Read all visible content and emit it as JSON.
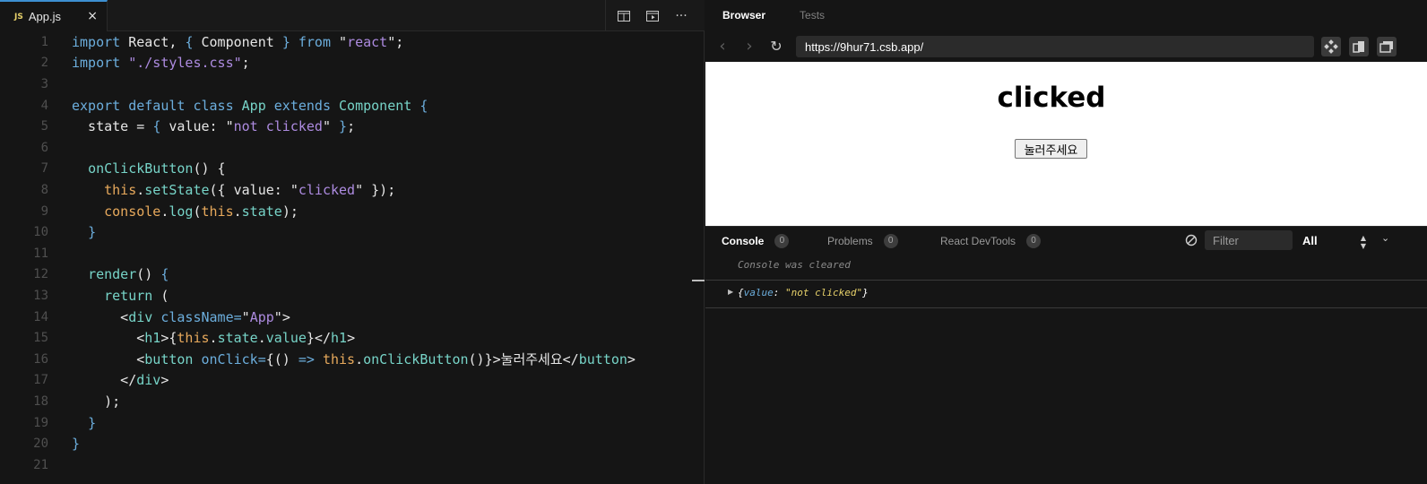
{
  "editor": {
    "tab": {
      "badge": "JS",
      "label": "App.js",
      "close": "×"
    },
    "actions": {
      "more": "···"
    },
    "line_numbers": [
      "1",
      "2",
      "3",
      "4",
      "5",
      "6",
      "7",
      "8",
      "9",
      "10",
      "11",
      "12",
      "13",
      "14",
      "15",
      "16",
      "17",
      "18",
      "19",
      "20",
      "21"
    ],
    "code": {
      "l1": {
        "a": "import",
        "b": " React, ",
        "c": "{",
        "d": " Component ",
        "e": "}",
        "f": " from ",
        "g": "\"",
        "h": "react",
        "i": "\"",
        "j": ";"
      },
      "l2": {
        "a": "import",
        "b": " ",
        "c": "\"./styles.css\"",
        "d": ";"
      },
      "l4": {
        "a": "export",
        "b": " ",
        "c": "default",
        "d": " ",
        "e": "class",
        "f": " ",
        "g": "App",
        "h": " ",
        "i": "extends",
        "j": " ",
        "k": "Component",
        "l": " ",
        "m": "{"
      },
      "l5": {
        "a": "  state = ",
        "b": "{",
        "c": " value: ",
        "d": "\"",
        "e": "not clicked",
        "f": "\"",
        "g": " ",
        "h": "}",
        "i": ";"
      },
      "l7": {
        "a": "  ",
        "b": "onClickButton",
        "c": "() {"
      },
      "l8": {
        "a": "    ",
        "b": "this",
        "c": ".",
        "d": "setState",
        "e": "({ value: ",
        "f": "\"",
        "g": "clicked",
        "h": "\"",
        "i": " });"
      },
      "l9": {
        "a": "    ",
        "b": "console",
        "c": ".",
        "d": "log",
        "e": "(",
        "f": "this",
        "g": ".",
        "h": "state",
        "i": ");"
      },
      "l10": {
        "a": "  ",
        "b": "}"
      },
      "l12": {
        "a": "  ",
        "b": "render",
        "c": "() ",
        "d": "{"
      },
      "l13": {
        "a": "    ",
        "b": "return",
        "c": " ("
      },
      "l14": {
        "a": "      <",
        "b": "div",
        "c": " ",
        "d": "className",
        "e": "=",
        "f": "\"",
        "g": "App",
        "h": "\"",
        "i": ">"
      },
      "l15": {
        "a": "        <",
        "b": "h1",
        "c": ">{",
        "d": "this",
        "e": ".",
        "f": "state",
        "g": ".",
        "h": "value",
        "i": "}</",
        "j": "h1",
        "k": ">"
      },
      "l16": {
        "a": "        <",
        "b": "button",
        "c": " ",
        "d": "onClick",
        "e": "=",
        "f": "{() ",
        "g": "=>",
        "h": " ",
        "i": "this",
        "j": ".",
        "k": "onClickButton",
        "l": "()}>눌러주세요</",
        "m": "button",
        "n": ">"
      },
      "l17": {
        "a": "      </",
        "b": "div",
        "c": ">"
      },
      "l18": {
        "a": "    );"
      },
      "l19": {
        "a": "  ",
        "b": "}"
      },
      "l20": {
        "a": "}"
      }
    }
  },
  "browser": {
    "tabs": [
      "Browser",
      "Tests"
    ],
    "url": "https://9hur71.csb.app/",
    "nav": {
      "back": "‹",
      "forward": "›",
      "reload": "↻"
    },
    "preview": {
      "heading": "clicked",
      "button_label": "눌러주세요"
    }
  },
  "console": {
    "tabs": [
      {
        "label": "Console",
        "count": "0"
      },
      {
        "label": "Problems",
        "count": "0"
      },
      {
        "label": "React DevTools",
        "count": "0"
      }
    ],
    "filter_placeholder": "Filter",
    "level": "All",
    "messages": {
      "cleared": "Console was cleared",
      "log": {
        "open": "{",
        "key": "value",
        "sep": ": ",
        "value": "\"not clicked\"",
        "close": "}"
      }
    }
  },
  "colors": {
    "accent": "#3d8fd1",
    "keyword": "#6caedd",
    "string": "#ad8be0",
    "identifier": "#77d4c8",
    "this": "#e7a95c",
    "js_badge": "#e7d16a"
  }
}
